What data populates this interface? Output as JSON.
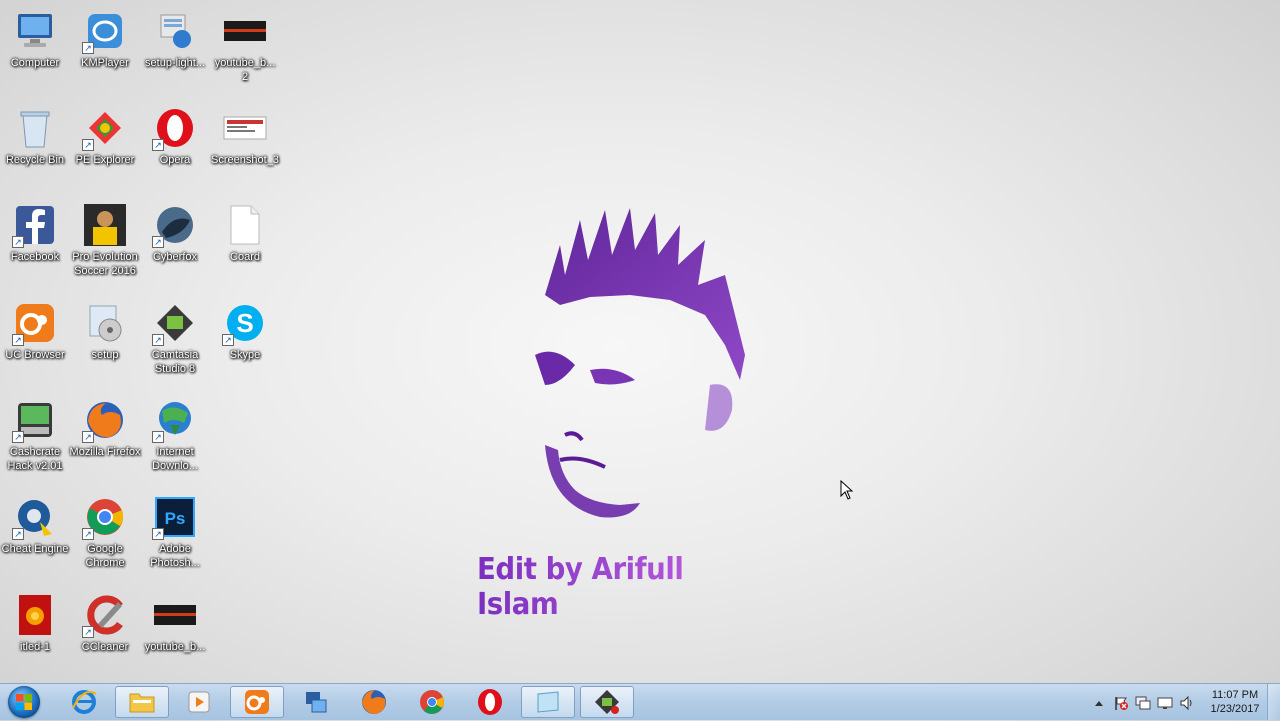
{
  "desktop": {
    "wallpaper_caption": "Edit by Arifull Islam",
    "icons": [
      {
        "label": "Computer",
        "icon": "computer-icon"
      },
      {
        "label": "KMPlayer",
        "icon": "kmplayer-icon"
      },
      {
        "label": "setup-light...",
        "icon": "setup-light-icon"
      },
      {
        "label": "youtube_b...\n2",
        "icon": "image-file-icon"
      },
      {
        "label": "Recycle Bin",
        "icon": "recycle-bin-icon"
      },
      {
        "label": "PE Explorer",
        "icon": "pe-explorer-icon"
      },
      {
        "label": "Opera",
        "icon": "opera-icon"
      },
      {
        "label": "Screenshot_3",
        "icon": "image-file-icon"
      },
      {
        "label": "Facebook",
        "icon": "facebook-icon"
      },
      {
        "label": "Pro Evolution Soccer 2016",
        "icon": "pes-icon"
      },
      {
        "label": "Cyberfox",
        "icon": "cyberfox-icon"
      },
      {
        "label": "Coard",
        "icon": "blank-file-icon"
      },
      {
        "label": "UC Browser",
        "icon": "uc-browser-icon"
      },
      {
        "label": "setup",
        "icon": "setup-icon"
      },
      {
        "label": "Camtasia Studio 8",
        "icon": "camtasia-icon"
      },
      {
        "label": "Skype",
        "icon": "skype-icon"
      },
      {
        "label": "Cashcrate Hack v2.01",
        "icon": "cashcrate-icon"
      },
      {
        "label": "Mozilla Firefox",
        "icon": "firefox-icon"
      },
      {
        "label": "Internet Downlo...",
        "icon": "idm-icon"
      },
      {
        "label": "Cheat Engine",
        "icon": "cheat-engine-icon"
      },
      {
        "label": "Google Chrome",
        "icon": "chrome-icon"
      },
      {
        "label": "Adobe Photosh...",
        "icon": "photoshop-icon"
      },
      {
        "label": "itled-1",
        "icon": "psd-file-icon"
      },
      {
        "label": "CCleaner",
        "icon": "ccleaner-icon"
      },
      {
        "label": "youtube_b...",
        "icon": "image-file-icon"
      }
    ]
  },
  "taskbar": {
    "start": "start-button",
    "pinned": [
      {
        "icon": "internet-explorer-icon",
        "active": false
      },
      {
        "icon": "file-explorer-icon",
        "active": true
      },
      {
        "icon": "media-player-icon",
        "active": false
      },
      {
        "icon": "uc-browser-icon",
        "active": true
      },
      {
        "icon": "network-tool-icon",
        "active": false
      },
      {
        "icon": "firefox-icon",
        "active": false
      },
      {
        "icon": "chrome-icon",
        "active": false
      },
      {
        "icon": "opera-icon",
        "active": false
      },
      {
        "icon": "notepad-icon",
        "active": true
      },
      {
        "icon": "camtasia-icon",
        "active": true
      }
    ],
    "tray_icons": [
      "show-hidden-icons-arrow",
      "action-center-flag-icon",
      "network-icon",
      "display-icon",
      "volume-icon"
    ],
    "clock": {
      "time": "11:07 PM",
      "date": "1/23/2017"
    }
  },
  "colors": {
    "taskbar": "#b4cde6",
    "caption_gradient_start": "#7b2fbf",
    "caption_gradient_end": "#c060e0"
  }
}
